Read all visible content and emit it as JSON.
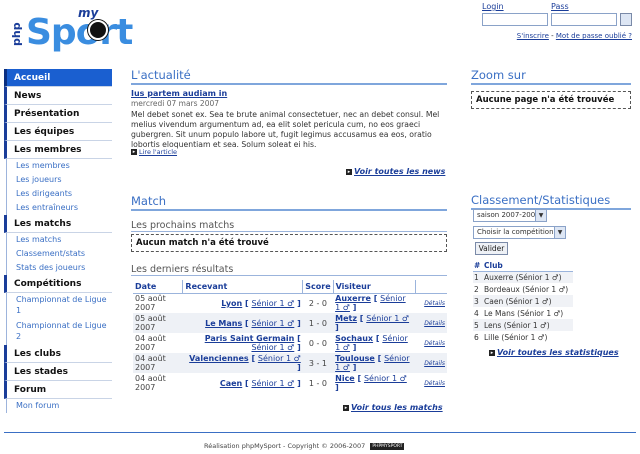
{
  "logo": {
    "php": "php",
    "my": "my",
    "sport": "Sport"
  },
  "login": {
    "login_label": "Login",
    "pass_label": "Pass",
    "signup": "S'inscrire",
    "separator": " - ",
    "forgot": "Mot de passe oublié ?"
  },
  "nav": {
    "accueil": "Accueil",
    "news": "News",
    "presentation": "Présentation",
    "equipes": "Les équipes",
    "membres": "Les membres",
    "membres_sub": [
      "Les membres",
      "Les joueurs",
      "Les dirigeants",
      "Les entraîneurs"
    ],
    "matchs": "Les matchs",
    "matchs_sub": [
      "Les matchs",
      "Classement/stats",
      "Stats des joueurs"
    ],
    "competitions": "Compétitions",
    "competitions_sub": [
      "Championnat de Ligue 1",
      "Championnat de Ligue 2"
    ],
    "clubs": "Les clubs",
    "stades": "Les stades",
    "forum": "Forum",
    "forum_sub": [
      "Mon forum"
    ]
  },
  "news": {
    "title": "L'actualité",
    "headline": "Ius partem audiam in",
    "date": "mercredi 07 mars 2007",
    "body": "Mel debet sonet ex. Sea te brute animal consectetuer, nec an debet consul. Mel melius vivendum argumentum ad, ea elit solet pericula cum, no eos graeci gubergren. Sit unum populo labore ut, fugit legimus accusamus ea eos, oratio lobortis eloquentiam et sea. Solum soleat ei his.",
    "read_more": "Lire l'article",
    "all": "Voir toutes les news"
  },
  "match": {
    "title": "Match",
    "upcoming_title": "Les prochains matchs",
    "no_match": "Aucun match n'a été trouvé",
    "results_title": "Les derniers résultats",
    "columns": [
      "Date",
      "Recevant",
      "Score",
      "Visiteur"
    ],
    "rows": [
      {
        "date": "05 août 2007",
        "home": "Lyon",
        "home_cat": "Sénior 1 ♂",
        "score": "2 - 0",
        "away": "Auxerre",
        "away_cat": "Sénior 1 ♂",
        "details": "Détails"
      },
      {
        "date": "05 août 2007",
        "home": "Le Mans",
        "home_cat": "Sénior 1 ♂",
        "score": "1 - 0",
        "away": "Metz",
        "away_cat": "Sénior 1 ♂",
        "details": "Détails"
      },
      {
        "date": "04 août 2007",
        "home": "Paris Saint Germain",
        "home_cat": "Sénior 1 ♂",
        "score": "0 - 0",
        "away": "Sochaux",
        "away_cat": "Sénior 1 ♂",
        "details": "Détails"
      },
      {
        "date": "04 août 2007",
        "home": "Valenciennes",
        "home_cat": "Sénior 1 ♂",
        "score": "3 - 1",
        "away": "Toulouse",
        "away_cat": "Sénior 1 ♂",
        "details": "Détails"
      },
      {
        "date": "04 août 2007",
        "home": "Caen",
        "home_cat": "Sénior 1 ♂",
        "score": "1 - 0",
        "away": "Nice",
        "away_cat": "Sénior 1 ♂",
        "details": "Détails"
      }
    ],
    "all": "Voir tous les matchs"
  },
  "zoom": {
    "title": "Zoom sur",
    "empty": "Aucune page n'a été trouvée"
  },
  "standings": {
    "title": "Classement/Statistiques",
    "season": "saison 2007-2008",
    "competition": "Choisir la compétition",
    "submit": "Valider",
    "columns": [
      "#",
      "Club"
    ],
    "rows": [
      {
        "pos": "1",
        "club": "Auxerre (Sénior 1 ♂)"
      },
      {
        "pos": "2",
        "club": "Bordeaux (Sénior 1 ♂)"
      },
      {
        "pos": "3",
        "club": "Caen (Sénior 1 ♂)"
      },
      {
        "pos": "4",
        "club": "Le Mans (Sénior 1 ♂)"
      },
      {
        "pos": "5",
        "club": "Lens (Sénior 1 ♂)"
      },
      {
        "pos": "6",
        "club": "Lille (Sénior 1 ♂)"
      }
    ],
    "all": "Voir toutes les statistiques"
  },
  "footer": {
    "text": "Réalisation phpMySport - Copyright © 2006-2007",
    "badge": "PHPMYSPORT"
  }
}
